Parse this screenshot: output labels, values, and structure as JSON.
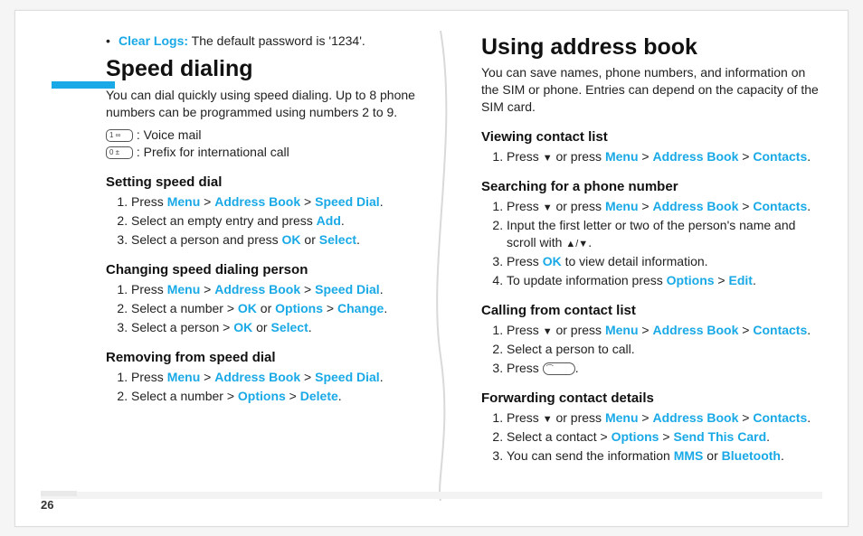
{
  "page_number": "26",
  "left": {
    "bullet_label": "Clear Logs:",
    "bullet_text": " The default password is '1234'.",
    "heading": "Speed dialing",
    "intro": "You can dial quickly using speed dialing. Up to 8 phone numbers can be programmed using numbers 2 to 9.",
    "key1_label": "1 ∞",
    "key1_text": " : Voice mail",
    "key0_label": "0 ±",
    "key0_text": " : Prefix for international call",
    "sec1_title": "Setting speed dial",
    "sec1": {
      "s1a": "Press ",
      "s1_menu": "Menu",
      "gt": " > ",
      "s1_ab": "Address Book",
      "s1_sd": "Speed Dial",
      "dot": ".",
      "s2a": "Select an empty entry and press ",
      "s2_add": "Add",
      "s3a": "Select a person and press ",
      "s3_ok": "OK",
      "or": " or ",
      "s3_sel": "Select"
    },
    "sec2_title": "Changing speed dialing person",
    "sec2": {
      "s1a": "Press ",
      "s2a": "Select a number > ",
      "s2_ok": "OK",
      "s2_opt": "Options",
      "s2_chg": "Change",
      "s3a": "Select a person > ",
      "s3_ok": "OK",
      "s3_sel": "Select"
    },
    "sec3_title": "Removing from speed dial",
    "sec3": {
      "s1a": "Press ",
      "s2a": "Select a number > ",
      "s2_opt": "Options",
      "s2_del": "Delete"
    }
  },
  "right": {
    "heading": "Using address book",
    "intro": "You can save names, phone numbers, and information on the SIM or phone. Entries can depend on the capacity of the SIM card.",
    "sec1_title": "Viewing contact list",
    "common": {
      "press": "Press ",
      "down": "▼",
      "orpress": " or press ",
      "menu": "Menu",
      "gt": " > ",
      "ab": "Address Book",
      "contacts": "Contacts",
      "dot": "."
    },
    "sec2_title": "Searching for a phone number",
    "sec2": {
      "s2": "Input the first letter or two of the person's name and scroll with ",
      "updown": "▲/▼",
      "s3a": "Press ",
      "s3_ok": "OK",
      "s3b": " to view detail information.",
      "s4a": "To update information press ",
      "s4_opt": "Options",
      "s4_edit": "Edit"
    },
    "sec3_title": "Calling from contact list",
    "sec3": {
      "s2": "Select a person to call.",
      "s3a": "Press ",
      "s3_key": "⌒"
    },
    "sec4_title": "Forwarding contact details",
    "sec4": {
      "s2a": "Select a contact > ",
      "s2_opt": "Options",
      "s2_send": "Send This Card",
      "s3a": "You can send the information ",
      "s3_mms": "MMS",
      "or": " or ",
      "s3_bt": "Bluetooth"
    }
  }
}
